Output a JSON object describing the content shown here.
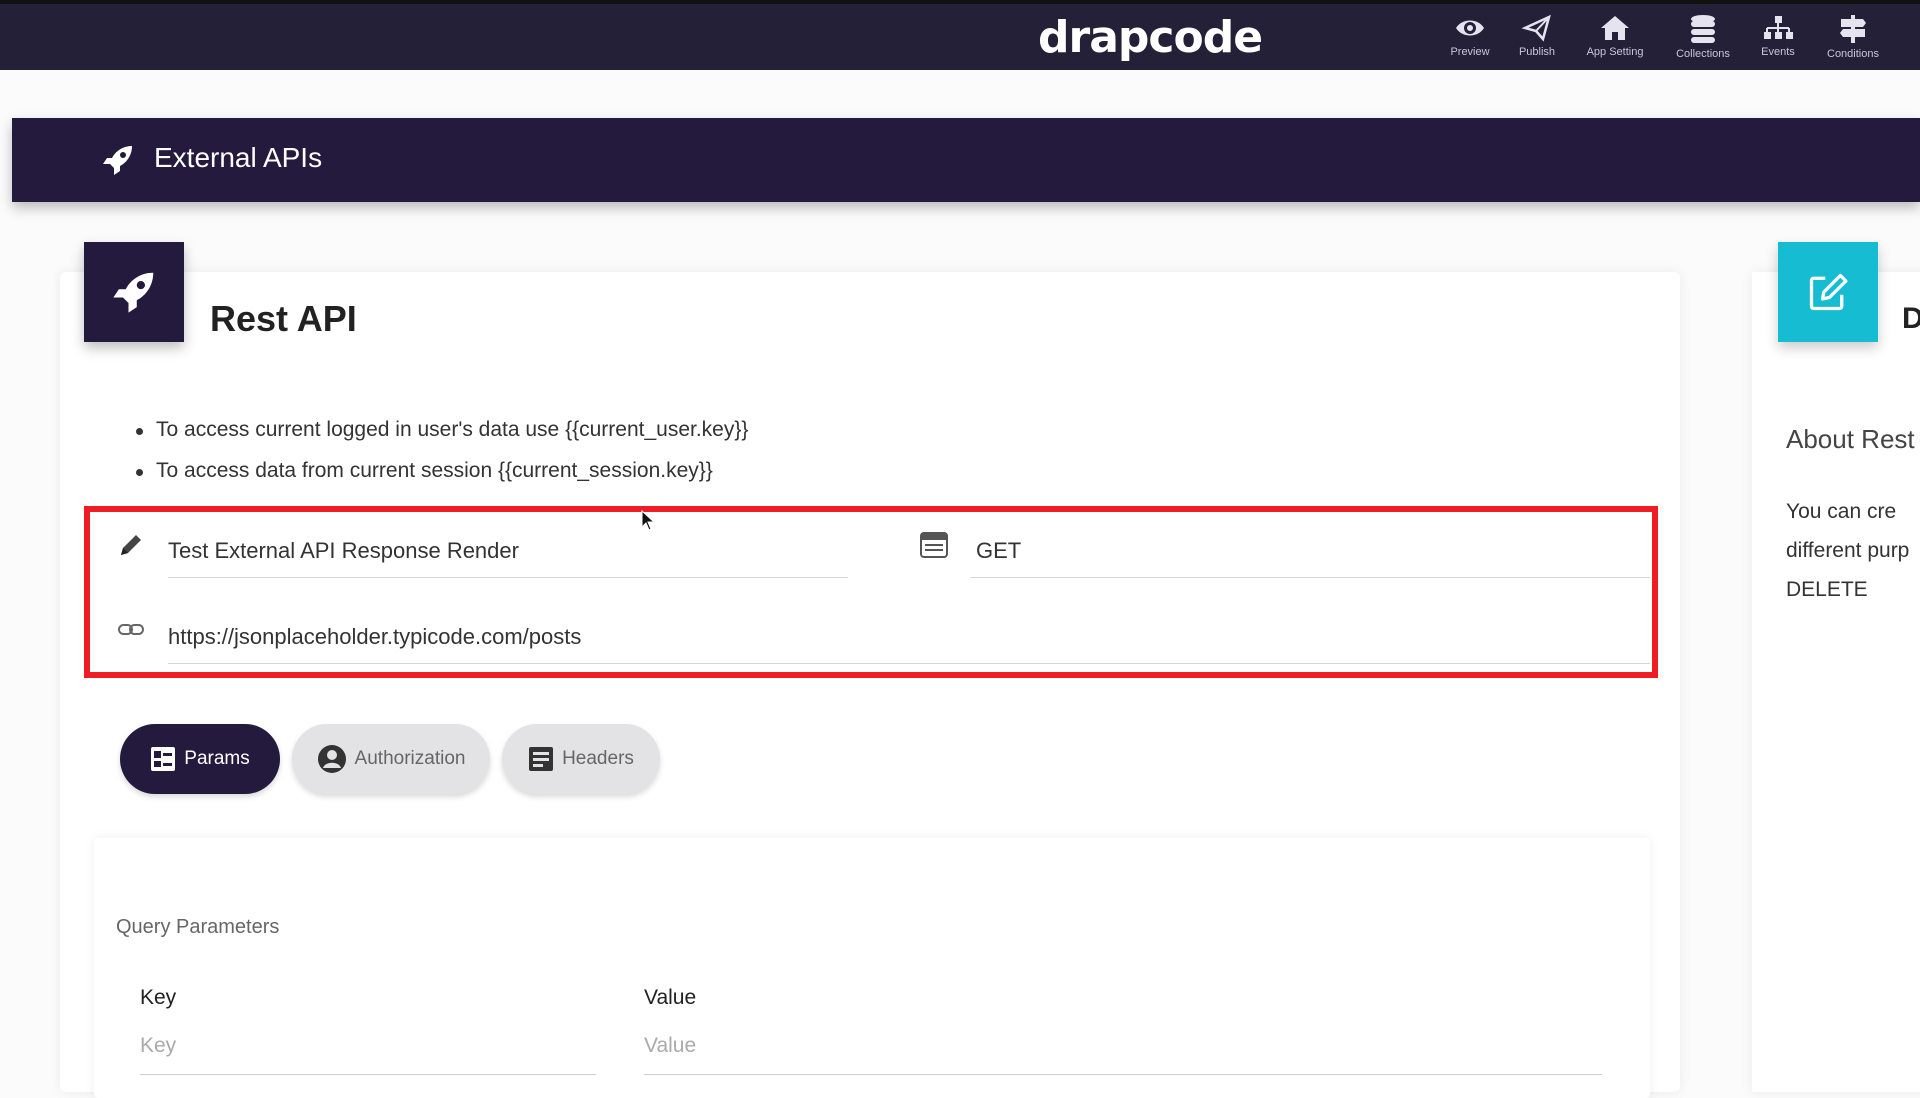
{
  "app": {
    "brand": "drapcode"
  },
  "topnav": {
    "items": [
      {
        "label": "Preview",
        "icon": "eye-icon"
      },
      {
        "label": "Publish",
        "icon": "paper-plane-icon"
      },
      {
        "label": "App Setting",
        "icon": "home-icon"
      },
      {
        "label": "Collections",
        "icon": "database-icon"
      },
      {
        "label": "Events",
        "icon": "sitemap-icon"
      },
      {
        "label": "Conditions",
        "icon": "signpost-icon"
      }
    ]
  },
  "page_header": {
    "title": "External APIs",
    "icon": "rocket-icon"
  },
  "rest_card": {
    "title": "Rest API",
    "icon": "rocket-icon",
    "notes": [
      "To access current logged in user's data use {{current_user.key}}",
      "To access data from current session {{current_session.key}}"
    ],
    "name_value": "Test External API Response Render",
    "method_value": "GET",
    "url_value": "https://jsonplaceholder.typicode.com/posts",
    "highlight_color": "#ee1c25"
  },
  "tabs": [
    {
      "label": "Params",
      "icon": "list-icon",
      "active": true
    },
    {
      "label": "Authorization",
      "icon": "user-circle-icon",
      "active": false
    },
    {
      "label": "Headers",
      "icon": "document-icon",
      "active": false
    }
  ],
  "query_params": {
    "title": "Query Parameters",
    "key_header": "Key",
    "value_header": "Value",
    "key_placeholder": "Key",
    "value_placeholder": "Value"
  },
  "side_card": {
    "title_fragment": "D",
    "icon": "edit-icon",
    "heading": "About Rest",
    "text_lines": [
      "You  can  cre",
      "different  purp",
      "DELETE"
    ]
  },
  "colors": {
    "navy": "#231a3d",
    "topbar": "#232038",
    "accent_cyan": "#16bcd1",
    "highlight_red": "#ee1c25"
  }
}
